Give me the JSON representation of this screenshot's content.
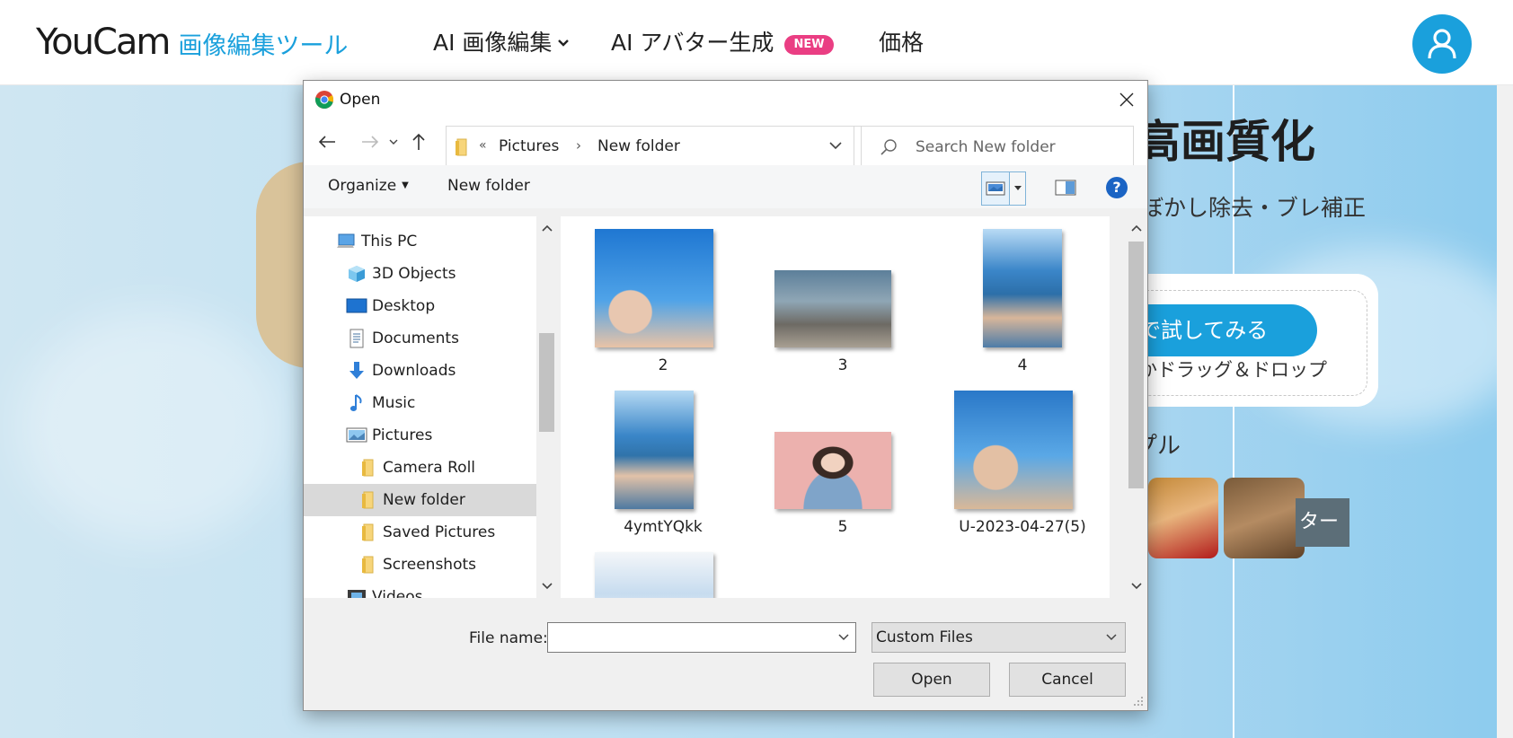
{
  "site": {
    "logo_main": "YouCam",
    "logo_sub": "画像編集ツール",
    "nav": [
      {
        "label": "AI 画像編集"
      },
      {
        "label": "AI アバター生成",
        "badge": "NEW"
      },
      {
        "label": "価格"
      }
    ],
    "hero_title": "高画質化",
    "hero_sub": "ぼかし除去・ブレ補正",
    "try_button": "で試してみる",
    "drop_text": "かドラッグ＆ドロップ",
    "sample_label": "プル",
    "sample_button": "ター",
    "colors": {
      "brand": "#1aa0dc",
      "badge": "#ea3e83"
    }
  },
  "dialog": {
    "title": "Open",
    "address": {
      "seg1": "Pictures",
      "seg2": "New folder"
    },
    "search_placeholder": "Search New folder",
    "toolbar": {
      "organize": "Organize",
      "new_folder": "New folder",
      "help": "?"
    },
    "tree": [
      {
        "label": "This PC",
        "icon": "computer-icon",
        "level": 0
      },
      {
        "label": "3D Objects",
        "icon": "cube-icon",
        "level": 1
      },
      {
        "label": "Desktop",
        "icon": "desktop-icon",
        "level": 1
      },
      {
        "label": "Documents",
        "icon": "document-icon",
        "level": 1
      },
      {
        "label": "Downloads",
        "icon": "download-arrow-icon",
        "level": 1
      },
      {
        "label": "Music",
        "icon": "music-note-icon",
        "level": 1
      },
      {
        "label": "Pictures",
        "icon": "pictures-icon",
        "level": 1
      },
      {
        "label": "Camera Roll",
        "icon": "folder-icon",
        "level": 2
      },
      {
        "label": "New folder",
        "icon": "folder-icon",
        "level": 2,
        "selected": true
      },
      {
        "label": "Saved Pictures",
        "icon": "folder-icon",
        "level": 2
      },
      {
        "label": "Screenshots",
        "icon": "folder-icon",
        "level": 2
      },
      {
        "label": "Videos",
        "icon": "film-icon",
        "level": 1
      }
    ],
    "files": [
      {
        "name": "2"
      },
      {
        "name": "3"
      },
      {
        "name": "4"
      },
      {
        "name": "4ymtYQkk"
      },
      {
        "name": "5"
      },
      {
        "name": "U-2023-04-27(5)"
      },
      {
        "name": ""
      }
    ],
    "file_name_label": "File name:",
    "file_name_value": "",
    "file_type": "Custom Files",
    "open_button": "Open",
    "cancel_button": "Cancel"
  }
}
